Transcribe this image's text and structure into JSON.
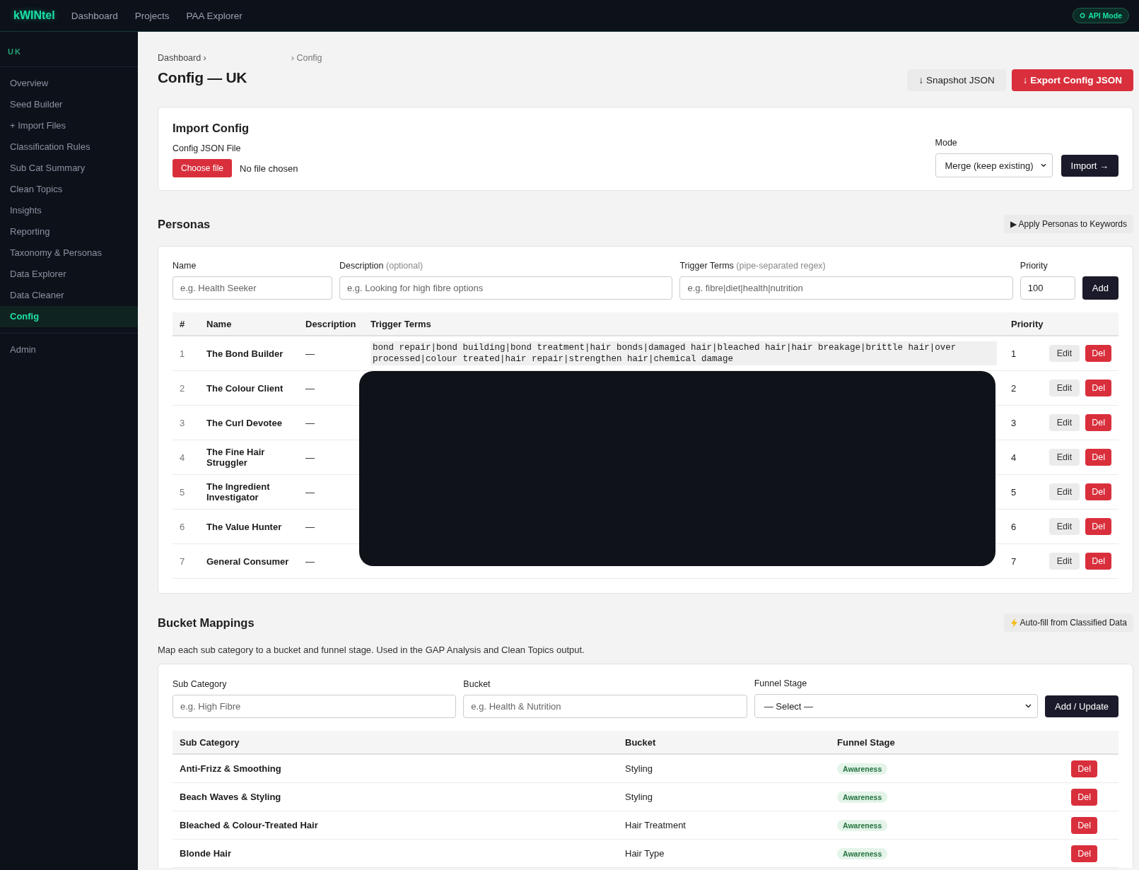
{
  "topbar": {
    "brand": "kWINtel",
    "nav": [
      "Dashboard",
      "Projects",
      "PAA Explorer"
    ],
    "mode_badge": "API Mode"
  },
  "sidebar": {
    "market": "UK",
    "items": [
      {
        "label": "Overview",
        "selected": false
      },
      {
        "label": "Seed Builder",
        "selected": false
      },
      {
        "label": "+ Import Files",
        "selected": false
      },
      {
        "label": "Classification Rules",
        "selected": false
      },
      {
        "label": "Sub Cat Summary",
        "selected": false
      },
      {
        "label": "Clean Topics",
        "selected": false
      },
      {
        "label": "Insights",
        "selected": false
      },
      {
        "label": "Reporting",
        "selected": false
      },
      {
        "label": "Taxonomy & Personas",
        "selected": false
      },
      {
        "label": "Data Explorer",
        "selected": false
      },
      {
        "label": "Data Cleaner",
        "selected": false
      },
      {
        "label": "Config",
        "selected": true
      }
    ],
    "footer_items": [
      {
        "label": "Admin",
        "selected": false
      }
    ]
  },
  "breadcrumb": [
    "Dashboard ›",
    "› Config"
  ],
  "page_title": "Config — UK",
  "header_buttons": [
    {
      "label": "↓ Snapshot JSON",
      "kind": "secondary"
    },
    {
      "label": "↓ Export Config JSON",
      "kind": "danger"
    }
  ],
  "import_config": {
    "title": "Import Config",
    "file_label": "Config JSON File",
    "choose_button": "Choose file",
    "file_status": "No file chosen",
    "mode_label": "Mode",
    "mode_value": "Merge (keep existing)",
    "import_button": "Import →"
  },
  "personas": {
    "title": "Personas",
    "apply_button": "▶ Apply Personas to Keywords",
    "form": {
      "fields": [
        {
          "label": "Name",
          "placeholder": "e.g. Health Seeker"
        },
        {
          "label": "Description",
          "hint": "(optional)",
          "placeholder": "e.g. Looking for high fibre options"
        },
        {
          "label": "Trigger Terms",
          "hint": "(pipe-separated regex)",
          "placeholder": "e.g. fibre|diet|health|nutrition"
        },
        {
          "label": "Priority",
          "value": "100"
        }
      ],
      "add_button": "Add"
    },
    "columns": [
      "#",
      "Name",
      "Description",
      "Trigger Terms",
      "Priority"
    ],
    "rows": [
      {
        "number": "1",
        "name": "The Bond Builder",
        "description": "—",
        "trigger_terms": "bond repair|bond building|bond treatment|hair bonds|damaged hair|bleached hair|hair breakage|brittle hair|over processed|colour treated|hair repair|strengthen hair|chemical damage",
        "priority": "1",
        "edit": "Edit",
        "delete": "Del"
      },
      {
        "number": "2",
        "name": "The Colour Client",
        "description": "—",
        "priority": "2",
        "edit": "Edit",
        "delete": "Del"
      },
      {
        "number": "3",
        "name": "The Curl Devotee",
        "description": "—",
        "priority": "3",
        "edit": "Edit",
        "delete": "Del"
      },
      {
        "number": "4",
        "name": "The Fine Hair Struggler",
        "description": "—",
        "priority": "4",
        "edit": "Edit",
        "delete": "Del"
      },
      {
        "number": "5",
        "name": "The Ingredient Investigator",
        "description": "—",
        "priority": "5",
        "edit": "Edit",
        "delete": "Del"
      },
      {
        "number": "6",
        "name": "The Value Hunter",
        "description": "—",
        "priority": "6",
        "edit": "Edit",
        "delete": "Del"
      },
      {
        "number": "7",
        "name": "General Consumer",
        "description": "—",
        "priority": "7",
        "edit": "Edit",
        "delete": "Del"
      }
    ]
  },
  "bucket_mappings": {
    "title": "Bucket Mappings",
    "autofill_button": "Auto-fill from Classified Data",
    "description": "Map each sub category to a bucket and funnel stage. Used in the GAP Analysis and Clean Topics output.",
    "form": {
      "fields": [
        {
          "label": "Sub Category",
          "kind": "input",
          "placeholder": "e.g. High Fibre"
        },
        {
          "label": "Bucket",
          "kind": "input",
          "placeholder": "e.g. Health & Nutrition"
        },
        {
          "label": "Funnel Stage",
          "kind": "select",
          "value": "— Select —"
        }
      ],
      "add_button": "Add / Update"
    },
    "columns": [
      "Sub Category",
      "Bucket",
      "Funnel Stage"
    ],
    "rows": [
      {
        "sub_category": "Anti-Frizz & Smoothing",
        "bucket": "Styling",
        "funnel_stage": "Awareness",
        "delete": "Del"
      },
      {
        "sub_category": "Beach Waves & Styling",
        "bucket": "Styling",
        "funnel_stage": "Awareness",
        "delete": "Del"
      },
      {
        "sub_category": "Bleached & Colour-Treated Hair",
        "bucket": "Hair Treatment",
        "funnel_stage": "Awareness",
        "delete": "Del"
      },
      {
        "sub_category": "Blonde Hair",
        "bucket": "Hair Type",
        "funnel_stage": "Awareness",
        "delete": "Del"
      }
    ]
  }
}
